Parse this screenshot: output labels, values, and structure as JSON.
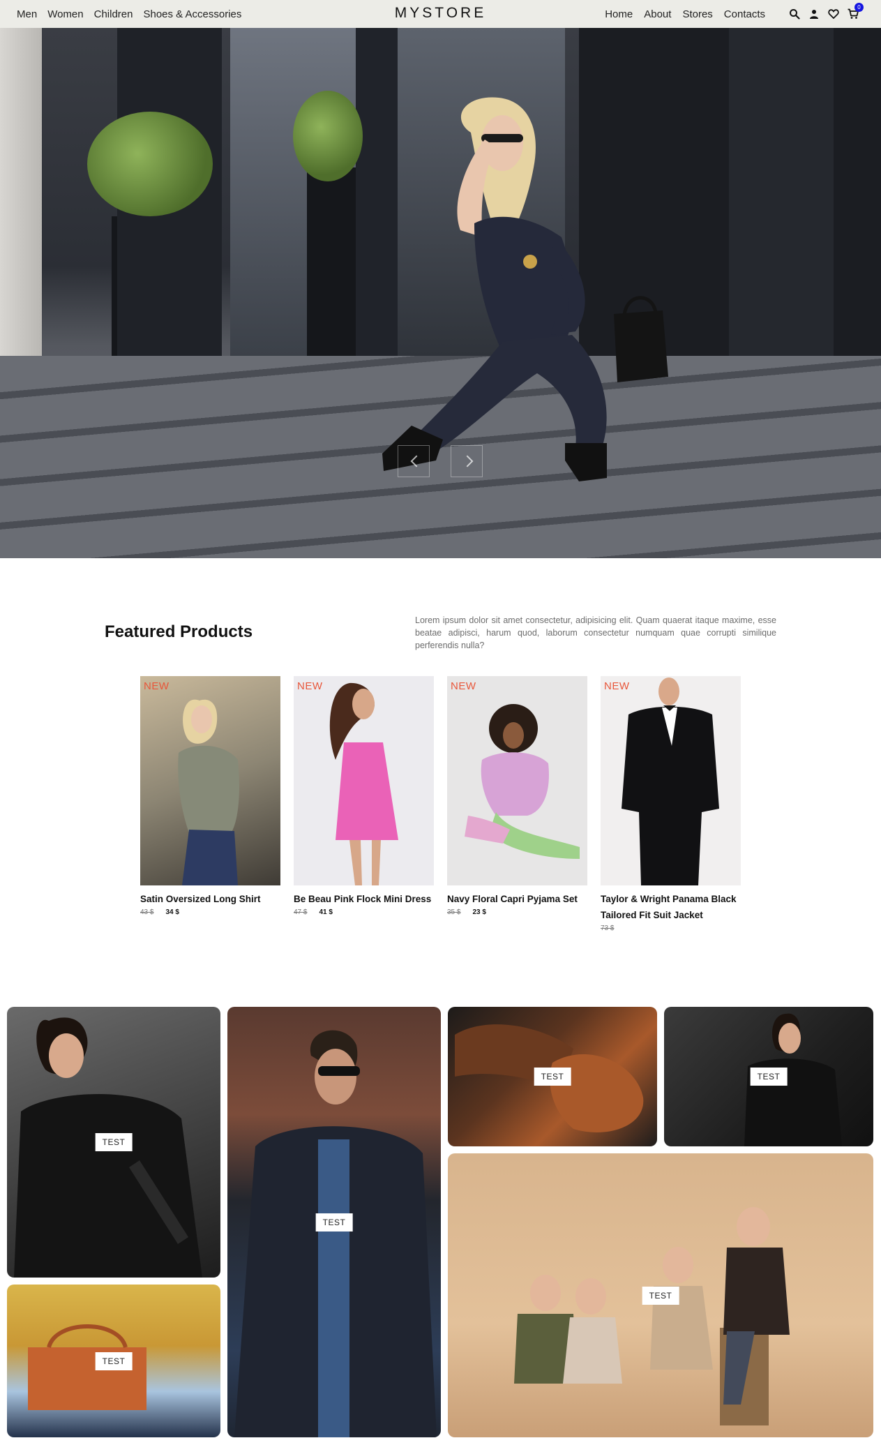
{
  "nav": {
    "left_items": [
      {
        "label": "Men"
      },
      {
        "label": "Women"
      },
      {
        "label": "Children"
      },
      {
        "label": "Shoes & Accessories"
      }
    ],
    "brand": "MYSTORE",
    "right_items": [
      {
        "label": "Home"
      },
      {
        "label": "About"
      },
      {
        "label": "Stores"
      },
      {
        "label": "Contacts"
      }
    ],
    "icons": [
      "search-icon",
      "user-icon",
      "heart-icon",
      "cart-icon"
    ],
    "cart_count": "0"
  },
  "hero": {
    "controls": [
      "prev",
      "next"
    ]
  },
  "featured": {
    "title": "Featured Products",
    "description": "Lorem ipsum dolor sit amet consectetur, adipisicing elit. Quam quaerat itaque maxime, esse beatae adipisci, harum quod, laborum consectetur numquam quae corrupti similique perferendis nulla?",
    "products": [
      {
        "tag": "NEW",
        "name": "Satin Oversized Long Shirt",
        "old_price": "43 $",
        "new_price": "34 $"
      },
      {
        "tag": "NEW",
        "name": "Be Beau Pink Flock Mini Dress",
        "old_price": "47 $",
        "new_price": "41 $"
      },
      {
        "tag": "NEW",
        "name": "Navy Floral Capri Pyjama Set",
        "old_price": "35 $",
        "new_price": "23 $"
      },
      {
        "tag": "NEW",
        "name": "Taylor & Wright Panama Black Tailored Fit Suit Jacket",
        "old_price": "73 $",
        "new_price": ""
      }
    ]
  },
  "gallery": {
    "tiles": [
      {
        "label": "TEST"
      },
      {
        "label": "TEST"
      },
      {
        "label": "TEST"
      },
      {
        "label": "TEST"
      },
      {
        "label": "TEST"
      },
      {
        "label": "TEST"
      }
    ]
  },
  "colors": {
    "nav_bg": "#ecece7",
    "new_tag": "#e8563a",
    "cart_badge": "#1515e0"
  }
}
